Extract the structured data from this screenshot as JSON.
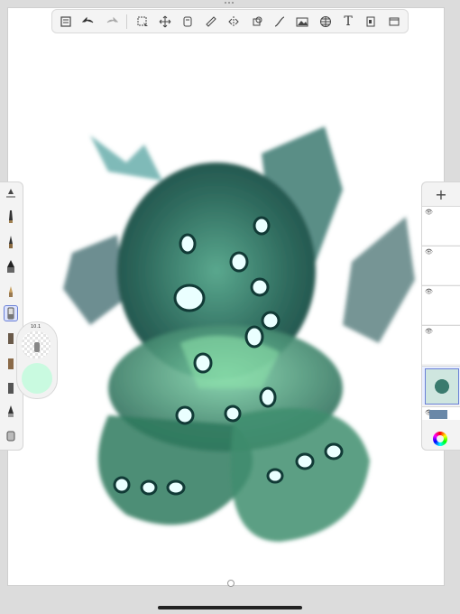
{
  "toolbar": {
    "items": [
      {
        "name": "gallery-icon"
      },
      {
        "name": "undo-icon"
      },
      {
        "name": "redo-icon"
      },
      {
        "name": "select-icon"
      },
      {
        "name": "move-icon"
      },
      {
        "name": "layers-copy-icon"
      },
      {
        "name": "ruler-icon"
      },
      {
        "name": "symmetry-icon"
      },
      {
        "name": "fill-icon"
      },
      {
        "name": "curve-icon"
      },
      {
        "name": "image-icon"
      },
      {
        "name": "perspective-grid-icon"
      },
      {
        "name": "text-tool",
        "label": "T"
      },
      {
        "name": "canvas-icon"
      },
      {
        "name": "fullscreen-icon"
      }
    ]
  },
  "brushes": {
    "active_index": 5
  },
  "brush_panel": {
    "size_label": "10.1"
  },
  "colors": {
    "current": "#c9fae0",
    "accent": "#6a80d6"
  },
  "layers": {
    "add_label": "+",
    "eye_icon": "👁"
  }
}
